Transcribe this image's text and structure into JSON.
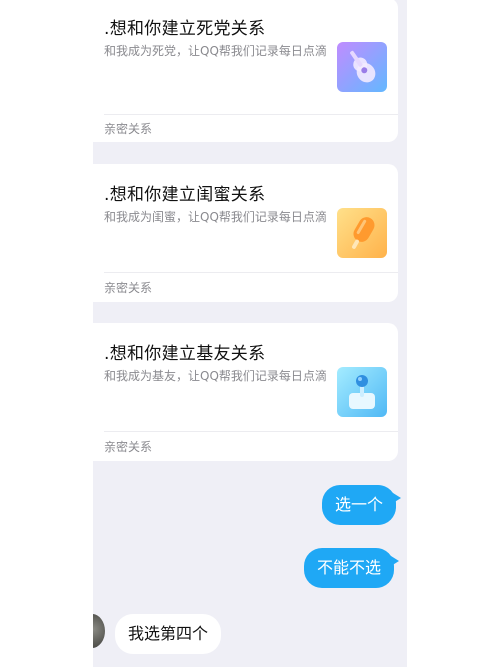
{
  "cards": [
    {
      "title": ".想和你建立死党关系",
      "description": "和我成为死党，让QQ帮我们记录每日点滴",
      "footer": "亲密关系",
      "icon": "guitar-icon",
      "thumb_colors": [
        "#b48cff",
        "#6fb7ff"
      ]
    },
    {
      "title": ".想和你建立闺蜜关系",
      "description": "和我成为闺蜜，让QQ帮我们记录每日点滴",
      "footer": "亲密关系",
      "icon": "popsicle-icon",
      "thumb_colors": [
        "#ffd46a",
        "#ff9f2e"
      ]
    },
    {
      "title": ".想和你建立基友关系",
      "description": "和我成为基友，让QQ帮我们记录每日点滴",
      "footer": "亲密关系",
      "icon": "joystick-icon",
      "thumb_colors": [
        "#8fe0ff",
        "#4fb8f5"
      ]
    }
  ],
  "messages": {
    "sent_1": "选一个",
    "sent_2": "不能不选",
    "received_1": "我选第四个"
  },
  "colors": {
    "bubble_sent": "#1fa8f5",
    "chat_background": "#efeff6"
  }
}
